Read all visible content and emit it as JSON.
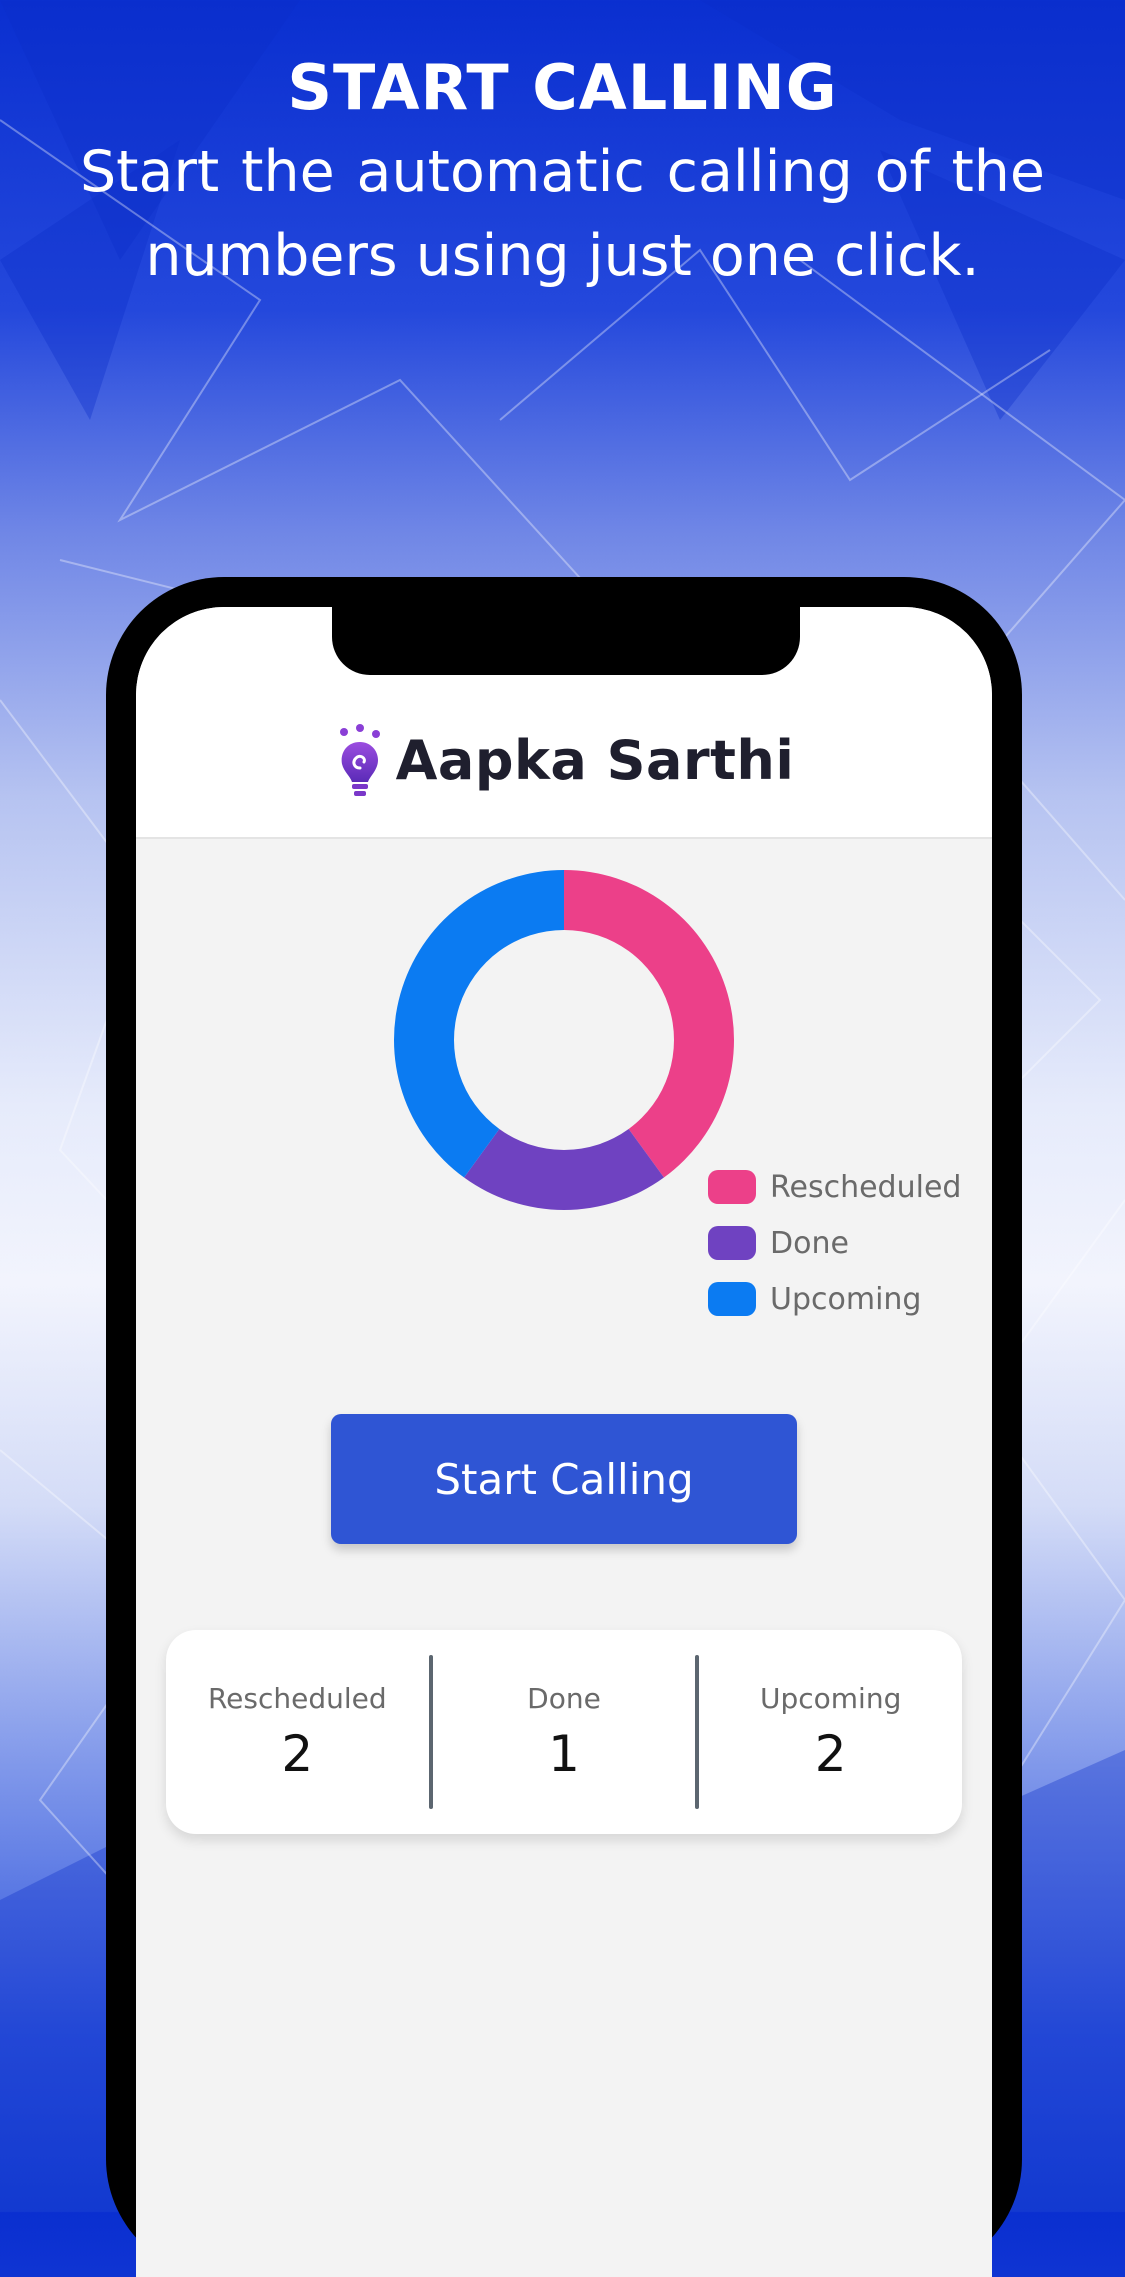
{
  "headline": {
    "title": "START CALLING",
    "subtitle": "Start the automatic calling of the numbers using just one click."
  },
  "app": {
    "brand_name": "Aapka Sarthi",
    "logo_icon": "lightbulb-swirl-icon"
  },
  "chart_data": {
    "type": "pie",
    "style": "donut",
    "categories": [
      "Rescheduled",
      "Done",
      "Upcoming"
    ],
    "values": [
      2,
      1,
      2
    ],
    "colors": [
      "#ec4089",
      "#6f42c1",
      "#0b7bf2"
    ],
    "legend_position": "bottom-right"
  },
  "legend": [
    {
      "label": "Rescheduled",
      "color": "#ec4089"
    },
    {
      "label": "Done",
      "color": "#6f42c1"
    },
    {
      "label": "Upcoming",
      "color": "#0b7bf2"
    }
  ],
  "actions": {
    "start_label": "Start Calling"
  },
  "stats": [
    {
      "label": "Rescheduled",
      "value": "2"
    },
    {
      "label": "Done",
      "value": "1"
    },
    {
      "label": "Upcoming",
      "value": "2"
    }
  ],
  "colors": {
    "primary_button": "#2f55d4",
    "background_blue": "#1740d4"
  }
}
